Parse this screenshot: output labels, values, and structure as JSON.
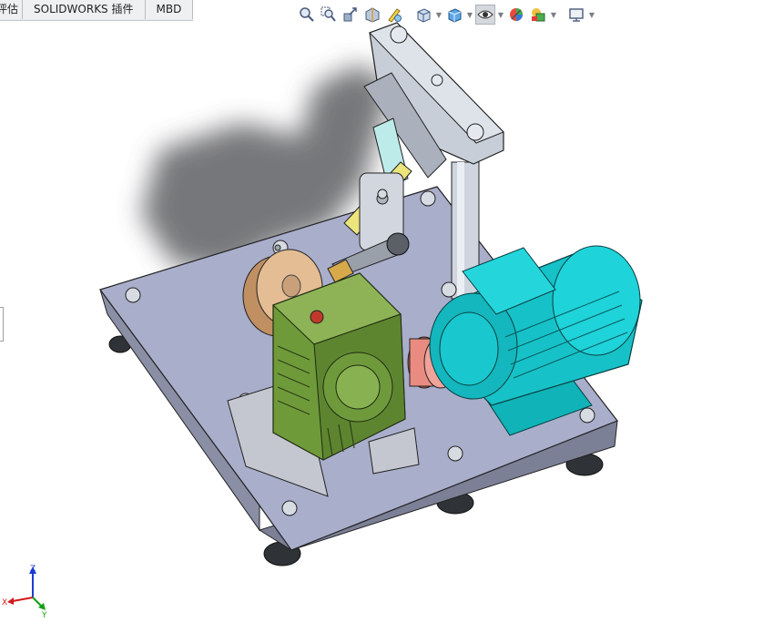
{
  "tabs": [
    {
      "label": "评估"
    },
    {
      "label": "SOLIDWORKS 插件"
    },
    {
      "label": "MBD"
    }
  ],
  "toolbar": {
    "icons": [
      "zoom-to-fit-icon",
      "zoom-to-area-icon",
      "previous-view-icon",
      "section-view-icon",
      "dynamic-annotation-icon",
      "view-orientation-icon",
      "display-style-icon",
      "hide-show-items-icon",
      "edit-appearance-icon",
      "apply-scene-icon",
      "view-settings-icon"
    ]
  },
  "triad": {
    "z": "Z",
    "x": "X",
    "y": "Y"
  },
  "colors": {
    "plate": "#aab0cc",
    "gearbox": "#6f9a3a",
    "motor": "#16c2c8",
    "coupling": "#e98b80",
    "pulley": "#e2b78c",
    "link": "#e9e27a",
    "post": "#cfd5de",
    "feet": "#3a3d42"
  }
}
